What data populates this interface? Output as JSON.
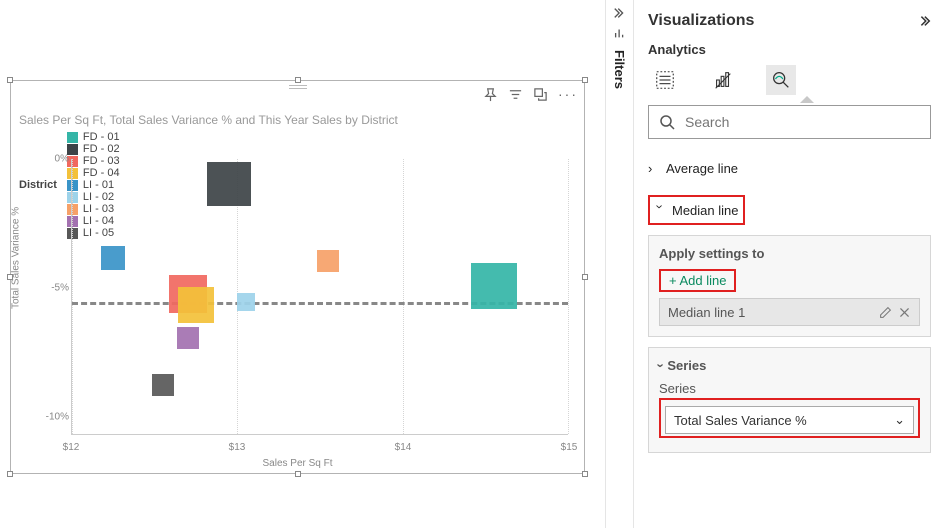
{
  "filters_label": "Filters",
  "panel": {
    "title": "Visualizations",
    "subtitle": "Analytics",
    "search_placeholder": "Search",
    "average_line_label": "Average line",
    "median_line_label": "Median line",
    "apply_settings_label": "Apply settings to",
    "add_line_label": "+ Add line",
    "line_item_name": "Median line 1",
    "series_section_label": "Series",
    "series_field_label": "Series",
    "series_value": "Total Sales Variance %"
  },
  "chart": {
    "title": "Sales Per Sq Ft, Total Sales Variance % and This Year Sales by District",
    "legend_title": "District",
    "ylabel": "Total Sales Variance %",
    "xlabel": "Sales Per Sq Ft",
    "legend": [
      {
        "key": "FD - 01",
        "color": "#34b5a7"
      },
      {
        "key": "FD - 02",
        "color": "#3d4347"
      },
      {
        "key": "FD - 03",
        "color": "#f1685f"
      },
      {
        "key": "FD - 04",
        "color": "#f3c13a"
      },
      {
        "key": "LI - 01",
        "color": "#3994c8"
      },
      {
        "key": "LI - 02",
        "color": "#9dd3ea"
      },
      {
        "key": "LI - 03",
        "color": "#f6a168"
      },
      {
        "key": "LI - 04",
        "color": "#a371b0"
      },
      {
        "key": "LI - 05",
        "color": "#585858"
      }
    ],
    "xticks": [
      "$12",
      "$13",
      "$14",
      "$15"
    ],
    "yticks": [
      "0%",
      "-5%",
      "-10%"
    ]
  },
  "chart_data": {
    "type": "scatter",
    "title": "Sales Per Sq Ft, Total Sales Variance % and This Year Sales by District",
    "xlabel": "Sales Per Sq Ft",
    "ylabel": "Total Sales Variance %",
    "xlim": [
      12,
      15
    ],
    "ylim": [
      -10,
      0
    ],
    "size_encodes": "This Year Sales",
    "median_line_y": -5.2,
    "series": [
      {
        "name": "FD - 01",
        "color": "#34b5a7",
        "x": 14.55,
        "y": -4.6,
        "size": 46
      },
      {
        "name": "FD - 02",
        "color": "#3d4347",
        "x": 12.95,
        "y": -0.9,
        "size": 44
      },
      {
        "name": "FD - 03",
        "color": "#f1685f",
        "x": 12.7,
        "y": -4.9,
        "size": 38
      },
      {
        "name": "FD - 04",
        "color": "#f3c13a",
        "x": 12.75,
        "y": -5.3,
        "size": 36
      },
      {
        "name": "LI - 01",
        "color": "#3994c8",
        "x": 12.25,
        "y": -3.6,
        "size": 24
      },
      {
        "name": "LI - 02",
        "color": "#9dd3ea",
        "x": 13.05,
        "y": -5.2,
        "size": 18
      },
      {
        "name": "LI - 03",
        "color": "#f6a168",
        "x": 13.55,
        "y": -3.7,
        "size": 22
      },
      {
        "name": "LI - 04",
        "color": "#a371b0",
        "x": 12.7,
        "y": -6.5,
        "size": 22
      },
      {
        "name": "LI - 05",
        "color": "#585858",
        "x": 12.55,
        "y": -8.2,
        "size": 22
      }
    ]
  }
}
